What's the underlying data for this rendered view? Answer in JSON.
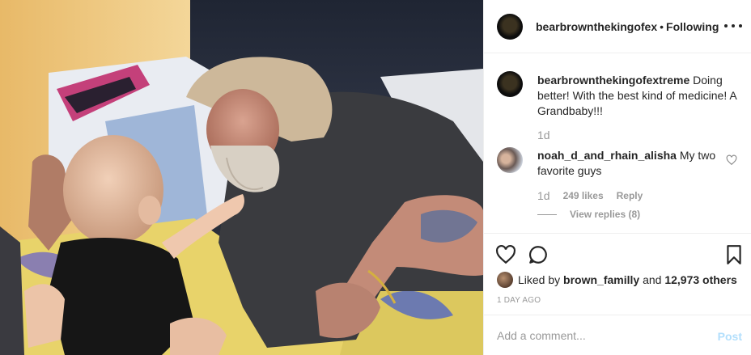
{
  "post": {
    "author": "bearbrownthekingofex",
    "separator": "•",
    "follow_status": "Following"
  },
  "caption": {
    "username": "bearbrownthekingofextreme",
    "text": "Doing better! With the best kind of medicine! A Grandbaby!!!",
    "age": "1d"
  },
  "comment": {
    "username": "noah_d_and_rhain_alisha",
    "text": "My two favorite guys",
    "age": "1d",
    "likes": "249 likes",
    "reply_label": "Reply",
    "view_replies": "View replies (8)"
  },
  "likes": {
    "prefix": "Liked by",
    "user": "brown_familly",
    "and": "and",
    "others": "12,973 others"
  },
  "timestamp": "1 DAY AGO",
  "add_comment": {
    "placeholder": "Add a comment...",
    "post_label": "Post"
  },
  "icons": [
    "more-icon",
    "heart-icon",
    "comment-icon",
    "bookmark-icon",
    "small-heart-icon"
  ],
  "colors": {
    "text": "#262626",
    "muted": "#999999",
    "post_disabled": "#b2dffc",
    "divider": "#efefef"
  }
}
